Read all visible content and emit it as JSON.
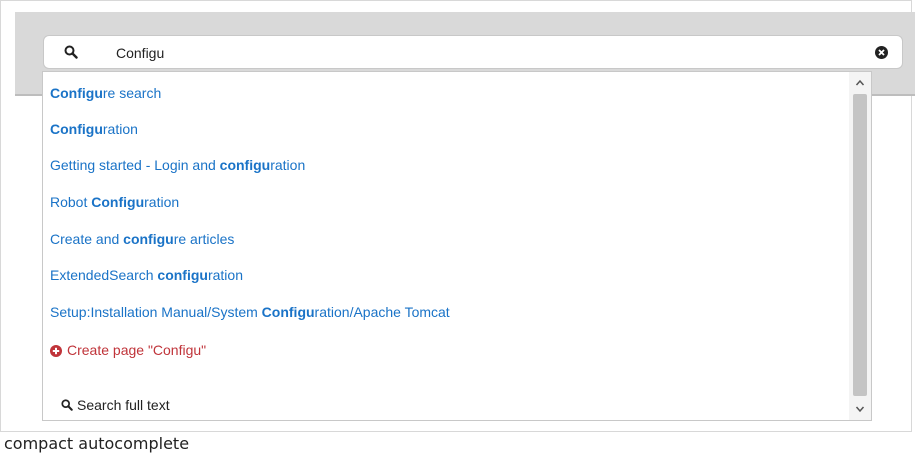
{
  "search": {
    "value": "Configu",
    "placeholder": ""
  },
  "suggestions": [
    {
      "bold": "Configu",
      "rest": "re search",
      "prefix": ""
    },
    {
      "bold": "Configu",
      "rest": "ration",
      "prefix": ""
    },
    {
      "prefix": "Getting started - Login and ",
      "bold": "configu",
      "rest": "ration"
    },
    {
      "prefix": "Robot ",
      "bold": "Configu",
      "rest": "ration"
    },
    {
      "prefix": "Create and ",
      "bold": "configu",
      "rest": "re articles"
    },
    {
      "prefix": "ExtendedSearch ",
      "bold": "configu",
      "rest": "ration"
    },
    {
      "prefix": "Setup:Installation Manual/System ",
      "bold": "Configu",
      "rest": "ration/Apache Tomcat"
    }
  ],
  "create_page": {
    "label": "Create page \"Configu\""
  },
  "full_text": {
    "label": "Search full text"
  },
  "caption": "compact autocomplete",
  "colors": {
    "link": "#1a73c7",
    "create": "#c0343a",
    "frame_bg": "#d9d9d9"
  }
}
